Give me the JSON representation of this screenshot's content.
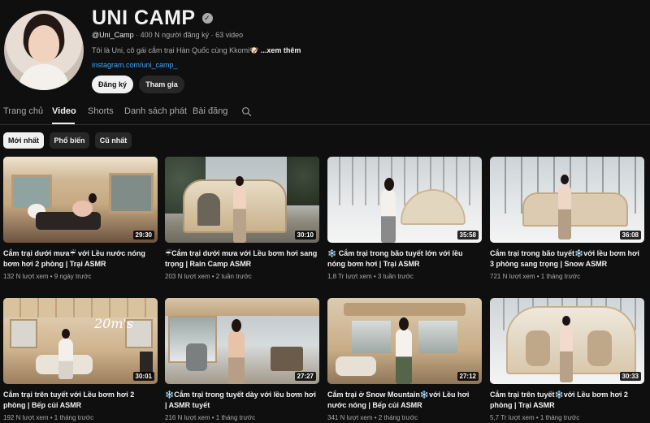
{
  "channel": {
    "name": "UNI CAMP",
    "handle": "@Uni_Camp",
    "stats": "· 400 N người đăng ký · 63 video",
    "description": "Tôi là Uni, cô gái cắm trại Hàn Quốc cùng Kkomi🐶",
    "more": "...xem thêm",
    "link": "instagram.com/uni_camp_",
    "subscribe_label": "Đăng ký",
    "join_label": "Tham gia"
  },
  "tabs": [
    "Trang chủ",
    "Video",
    "Shorts",
    "Danh sách phát",
    "Bài đăng"
  ],
  "chips": [
    "Mới nhất",
    "Phổ biến",
    "Cũ nhất"
  ],
  "videos": [
    {
      "title": "Cắm trại dưới mưa☔ với Lều nước nóng bơm hơi 2 phòng | Trại ASMR",
      "meta": "132 N lượt xem • 9 ngày trước",
      "duration": "29:30"
    },
    {
      "title": "☔Cắm trại dưới mưa với Lều bơm hơi sang trọng | Rain Camp ASMR",
      "meta": "203 N lượt xem • 2 tuần trước",
      "duration": "30:10"
    },
    {
      "title": "❄️ Cắm trại trong bão tuyết lớn với lều nóng bơm hơi | Trại ASMR",
      "meta": "1,8 Tr lượt xem • 3 tuần trước",
      "duration": "35:58"
    },
    {
      "title": "Cắm trại trong bão tuyết❄️với lều bơm hơi 3 phòng sang trọng | Snow ASMR",
      "meta": "721 N lượt xem • 1 tháng trước",
      "duration": "36:08"
    },
    {
      "title": "Cắm trại trên tuyết với Lều bơm hơi 2 phòng | Bếp củi ASMR",
      "meta": "192 N lượt xem • 1 tháng trước",
      "duration": "30:01"
    },
    {
      "title": "❄️Cắm trại trong tuyết dày với lều bơm hơi | ASMR tuyết",
      "meta": "216 N lượt xem • 1 tháng trước",
      "duration": "27:27"
    },
    {
      "title": "Cắm trại ở Snow Mountain❄️với Lều hơi nước nóng | Bếp củi ASMR",
      "meta": "341 N lượt xem • 2 tháng trước",
      "duration": "27:12"
    },
    {
      "title": "Cắm trại trên tuyết❄️với Lều bơm hơi 2 phòng | Trại ASMR",
      "meta": "5,7 Tr lượt xem • 1 tháng trước",
      "duration": "30:33"
    }
  ],
  "thumb_text": "20m's"
}
